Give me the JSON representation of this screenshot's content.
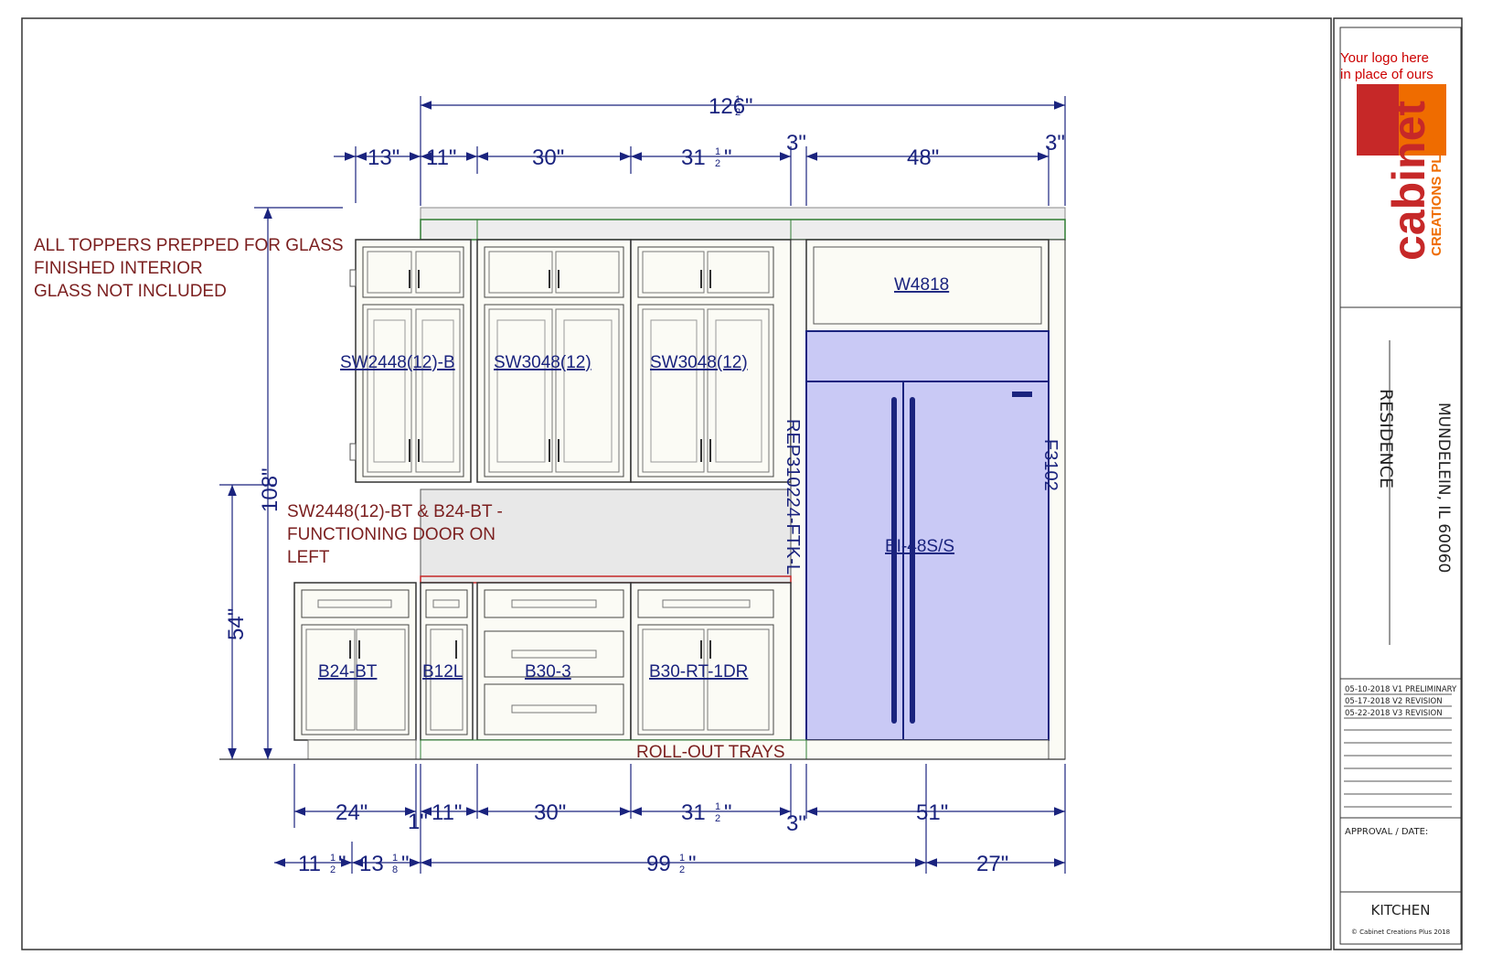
{
  "logo": {
    "placeholder_line1": "Your logo here",
    "placeholder_line2": "in place of ours",
    "brand_word": "cabinet",
    "brand_sub": "CREATIONS PLUS"
  },
  "notes": {
    "toppers_line1": "ALL TOPPERS PREPPED FOR GLASS",
    "toppers_line2": "FINISHED INTERIOR",
    "toppers_line3": "GLASS NOT INCLUDED",
    "bt_line1": "SW2448(12)-BT & B24-BT -",
    "bt_line2": "FUNCTIONING DOOR ON",
    "bt_line3": "LEFT",
    "rollout": "ROLL-OUT TRAYS"
  },
  "cabinets": {
    "sw2448": "SW2448(12)-B",
    "sw3048_a": "SW3048(12)",
    "sw3048_b": "SW3048(12)",
    "w4818": "W4818",
    "fridge": "BI-48S/S",
    "rep_panel": "REP310224-FTK-L",
    "filler": "F3102",
    "b24": "B24-BT",
    "b12": "B12L",
    "b30_3": "B30-3",
    "b30_rt": "B30-RT-1DR"
  },
  "dims": {
    "overall_top": {
      "whole": "126",
      "num": "1",
      "den": "2"
    },
    "top_13": "13\"",
    "top_11": "11\"",
    "top_30": "30\"",
    "top_31": {
      "whole": "31",
      "num": "1",
      "den": "2"
    },
    "top_3a": "3\"",
    "top_48": "48\"",
    "top_3b": "3\"",
    "height_108": "108\"",
    "height_54": "54\"",
    "bot_24": "24\"",
    "bot_1": "1\"",
    "bot_11": "11\"",
    "bot_30": "30\"",
    "bot_31": {
      "whole": "31",
      "num": "1",
      "den": "2"
    },
    "bot_3": "3\"",
    "bot_51": "51\"",
    "low_11": {
      "whole": "11",
      "num": "1",
      "den": "2"
    },
    "low_13": {
      "whole": "13",
      "num": "1",
      "den": "8"
    },
    "low_99": {
      "whole": "99",
      "num": "1",
      "den": "2"
    },
    "low_27": "27\""
  },
  "titleblock": {
    "project": "RESIDENCE",
    "address": "MUNDELEIN, IL 60060",
    "rev1": "05-10-2018 V1 PRELIMINARY",
    "rev2": "05-17-2018 V2 REVISION",
    "rev3": "05-22-2018 V3 REVISION",
    "approval": "APPROVAL / DATE:",
    "room": "KITCHEN",
    "copyright": "© Cabinet Creations Plus 2018"
  },
  "colors": {
    "dimension": "#1a237e",
    "note": "#7b1f1f",
    "fridge_fill": "#c9c9f5",
    "cabinet_fill": "#fbfbf5",
    "logo_red": "#c62828",
    "logo_orange": "#ef6c00"
  }
}
